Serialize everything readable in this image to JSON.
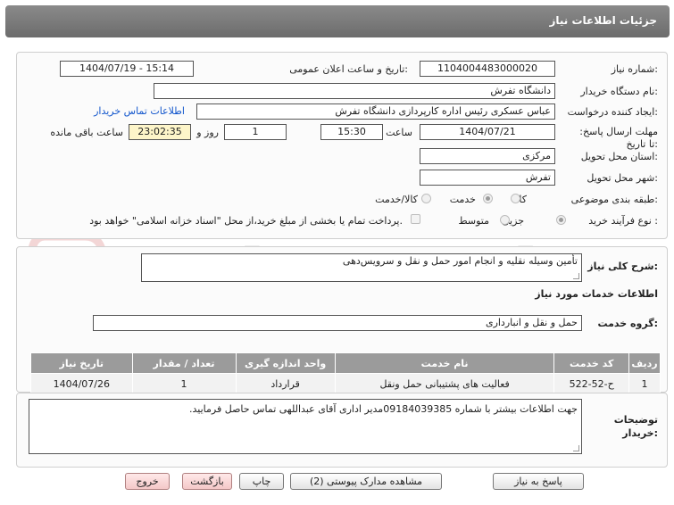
{
  "header": {
    "title": "جزئیات اطلاعات نیاز"
  },
  "details": {
    "need_number_label": "شماره نیاز:",
    "need_number": "1104004483000020",
    "announce_label": "تاریخ و ساعت اعلان عمومی:",
    "announce_value": "1404/07/19 - 15:14",
    "buyer_org_label": "نام دستگاه خریدار:",
    "buyer_org": "دانشگاه تفرش",
    "creator_label": "ایجاد کننده درخواست:",
    "creator": "عباس عسکری رئیس اداره کارپردازی دانشگاه تفرش",
    "contact_link": "اطلاعات تماس خریدار",
    "deadline_label": "مهلت ارسال پاسخ: تا تاریخ:",
    "deadline_date": "1404/07/21",
    "time_label": "ساعت",
    "deadline_time": "15:30",
    "days_value": "1",
    "days_label": "روز و",
    "remaining_time": "23:02:35",
    "remaining_label": "ساعت باقی مانده",
    "province_label": "استان محل تحویل:",
    "province": "مرکزی",
    "city_label": "شهر محل تحویل:",
    "city": "تفرش",
    "category_label": "طبقه بندی موضوعی:",
    "category_options": [
      "کالا",
      "خدمت",
      "کالا/خدمت"
    ],
    "process_label": "نوع فرآیند خرید :",
    "process_options": [
      "جزیی",
      "متوسط"
    ],
    "payment_note": "پرداخت تمام یا بخشی از مبلغ خرید،از محل \"اسناد خزانه اسلامی\" خواهد بود."
  },
  "summary": {
    "label": "شرح کلی نیاز:",
    "value": "تأمین وسیله نقلیه و انجام امور حمل و نقل و سرویس‌دهی"
  },
  "services": {
    "section_title": "اطلاعات خدمات مورد نیاز",
    "group_label": "گروه خدمت:",
    "group_value": "حمل و نقل و انبارداری",
    "columns": [
      "ردیف",
      "کد خدمت",
      "نام خدمت",
      "واحد اندازه گیری",
      "تعداد / مقدار",
      "تاریخ نیاز"
    ],
    "rows": [
      [
        "1",
        "ح-52-522",
        "فعالیت های پشتیبانی حمل ونقل",
        "قرارداد",
        "1",
        "1404/07/26"
      ]
    ]
  },
  "buyer_notes": {
    "label_line1": "توضیحات",
    "label_line2": "خریدار:",
    "value": "جهت اطلاعات بیشتر با شماره 09184039385مدیر اداری آقای عبداللهی تماس حاصل فرمایید."
  },
  "buttons": {
    "reply": "پاسخ به نیاز",
    "attachments": "مشاهده مدارک پیوستی (2)",
    "print": "چاپ",
    "back": "بازگشت",
    "exit": "خروج"
  },
  "colors": {
    "header": "#7a7a7a",
    "table_header": "#9b9b9b",
    "yellow_field": "#fdf5c9",
    "link": "#1155cc"
  }
}
